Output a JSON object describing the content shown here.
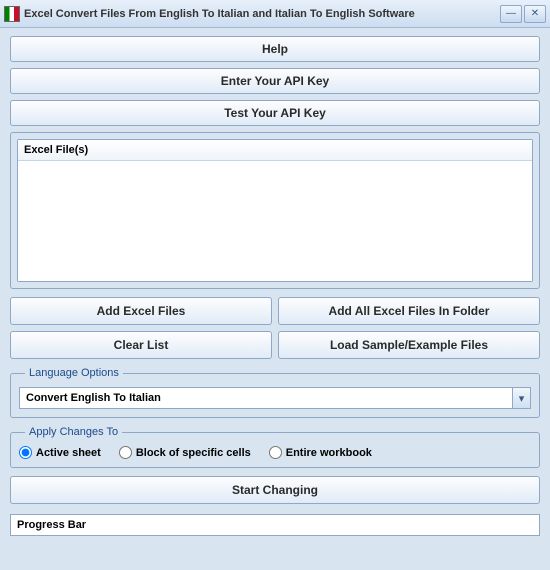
{
  "window": {
    "title": "Excel Convert Files From English To Italian and Italian To English Software"
  },
  "buttons": {
    "help": "Help",
    "enter_api": "Enter Your API Key",
    "test_api": "Test Your API Key",
    "add_files": "Add Excel Files",
    "add_folder": "Add All Excel Files In Folder",
    "clear_list": "Clear List",
    "load_sample": "Load Sample/Example Files",
    "start": "Start Changing"
  },
  "list": {
    "header": "Excel File(s)"
  },
  "language": {
    "legend": "Language Options",
    "selected": "Convert English To Italian"
  },
  "apply": {
    "legend": "Apply Changes To",
    "options": {
      "active": "Active sheet",
      "block": "Block of specific cells",
      "entire": "Entire workbook"
    },
    "selected": "active"
  },
  "progress": {
    "label": "Progress Bar"
  }
}
